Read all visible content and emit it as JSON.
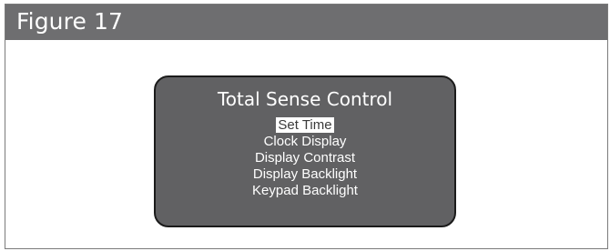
{
  "figure": {
    "title": "Figure 17"
  },
  "screen": {
    "title": "Total Sense Control",
    "menu_items": [
      {
        "label": "Set Time",
        "selected": true
      },
      {
        "label": "Clock Display",
        "selected": false
      },
      {
        "label": "Display Contrast",
        "selected": false
      },
      {
        "label": "Display Backlight",
        "selected": false
      },
      {
        "label": "Keypad Backlight",
        "selected": false
      }
    ]
  },
  "colors": {
    "header_background": "#6e6e70",
    "screen_background": "#616163",
    "text": "#ffffff",
    "selection_highlight": "#ffffff"
  }
}
